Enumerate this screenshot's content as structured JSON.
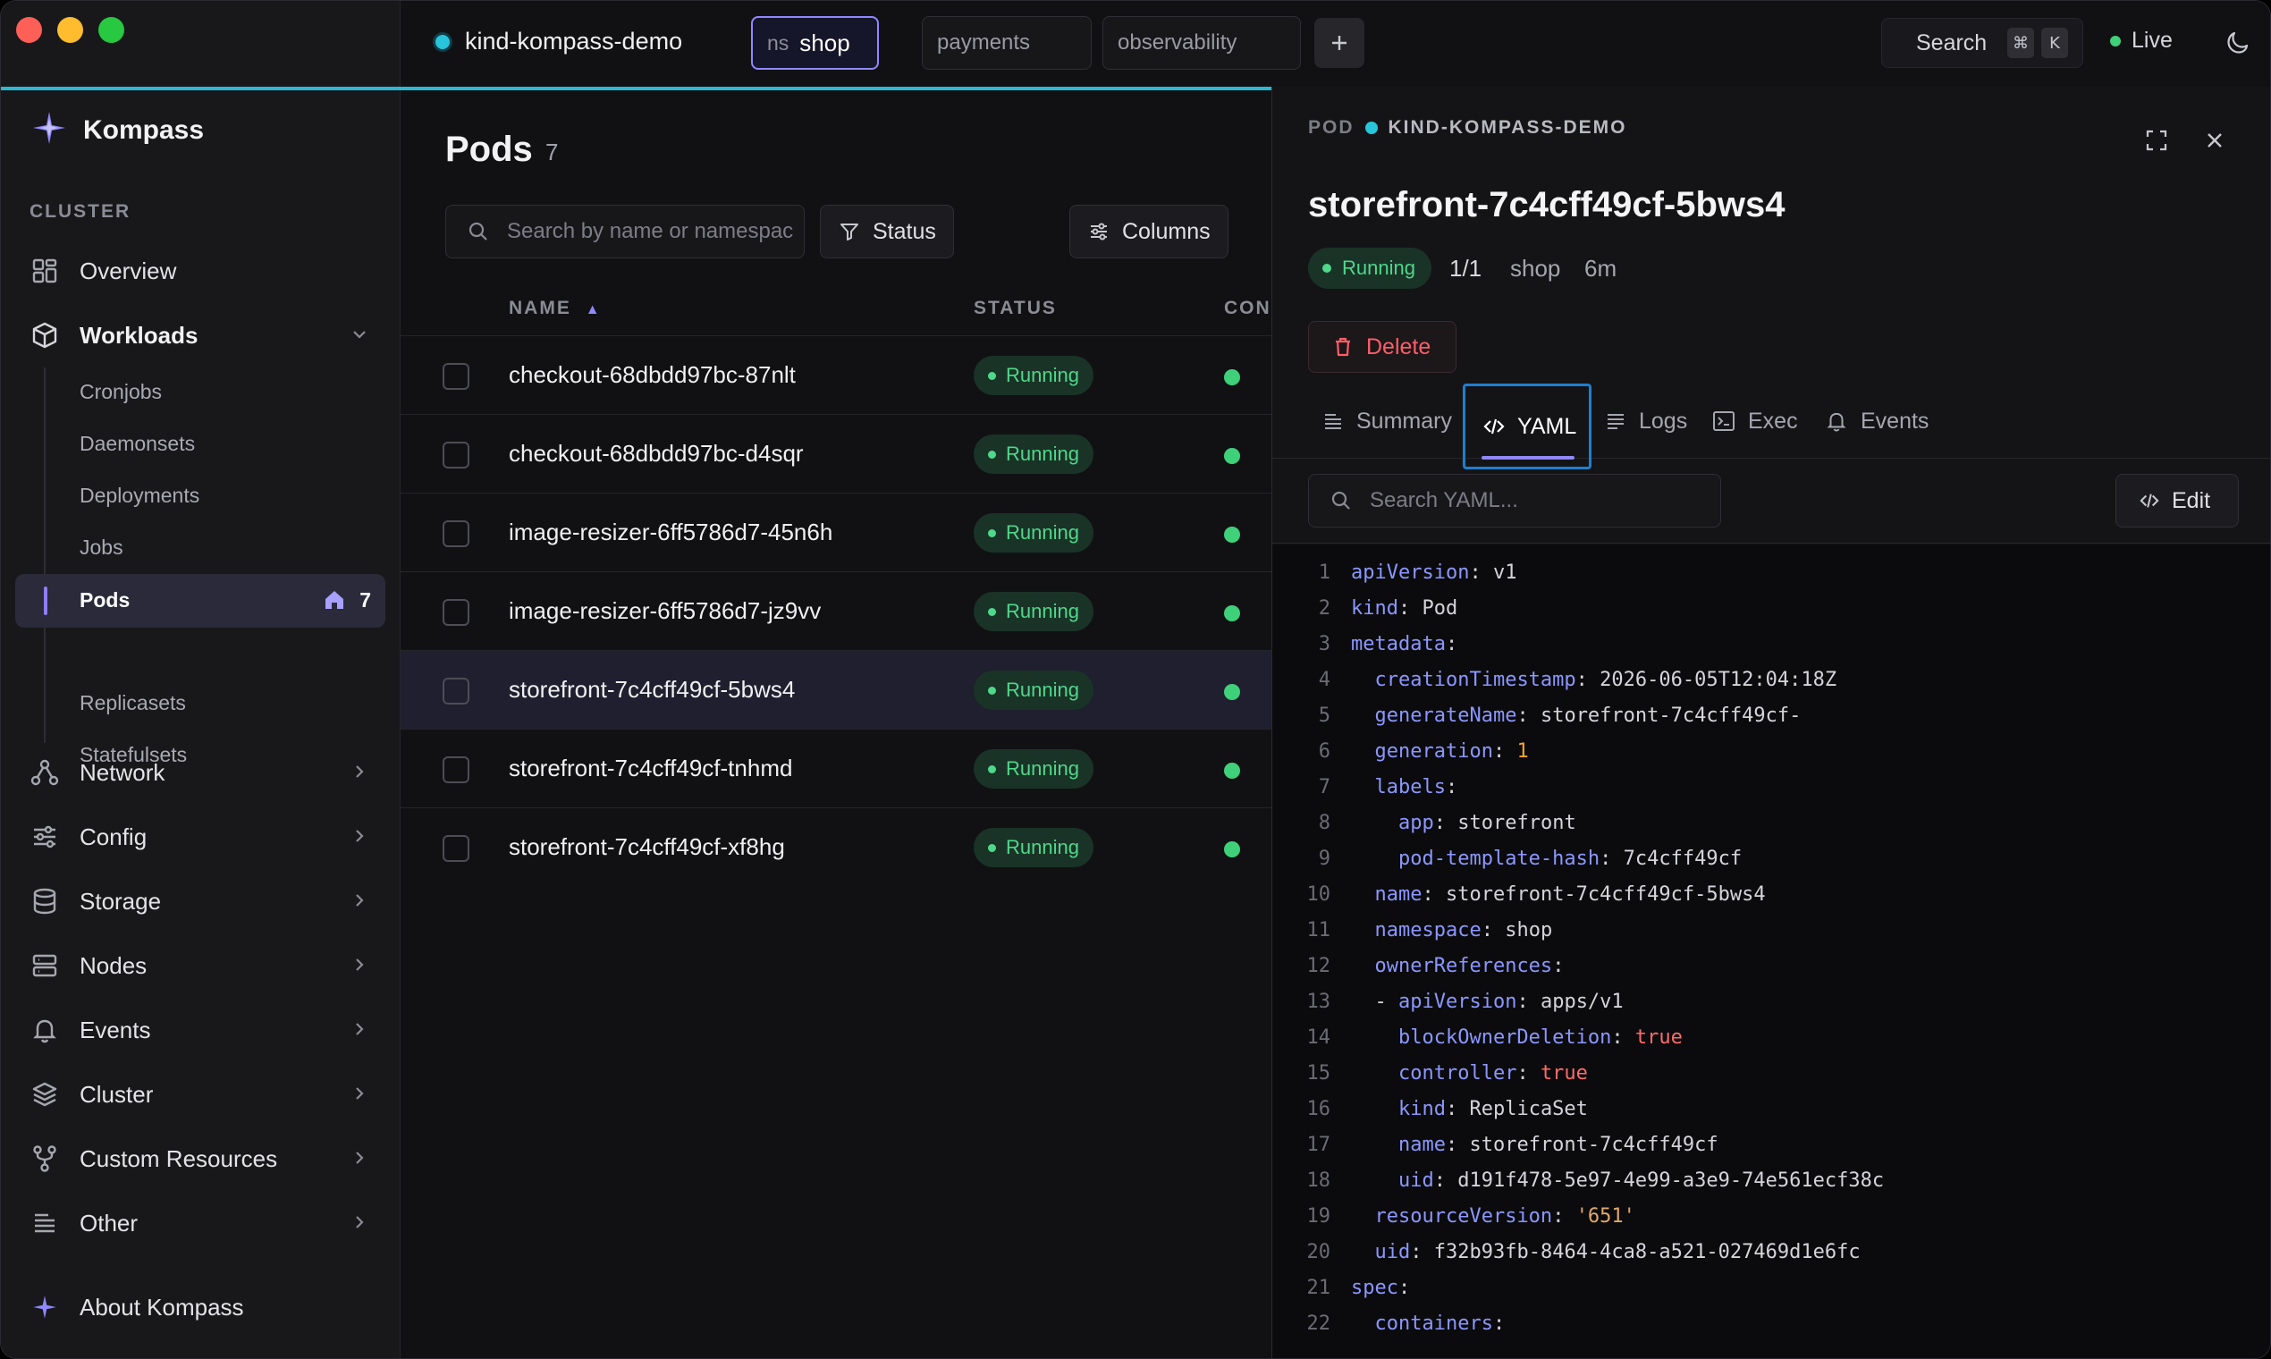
{
  "app": {
    "name": "Kompass",
    "accent": "#8f88ff",
    "context_color": "#27c4dc"
  },
  "topbar": {
    "context": "kind-kompass-demo",
    "ns_prefix": "ns",
    "ns_value": "shop",
    "namespaces": [
      "payments",
      "observability"
    ],
    "search_label": "Search",
    "kbd_cmd": "⌘",
    "kbd_k": "K",
    "live_label": "Live"
  },
  "sidebar": {
    "section": "CLUSTER",
    "items": [
      {
        "label": "Overview",
        "icon": "grid-icon"
      },
      {
        "label": "Workloads",
        "icon": "cube-icon"
      },
      {
        "label": "Network",
        "icon": "network-icon"
      },
      {
        "label": "Config",
        "icon": "sliders-icon"
      },
      {
        "label": "Storage",
        "icon": "database-icon"
      },
      {
        "label": "Nodes",
        "icon": "server-icon"
      },
      {
        "label": "Events",
        "icon": "bell-icon"
      },
      {
        "label": "Cluster",
        "icon": "layers-icon"
      },
      {
        "label": "Custom Resources",
        "icon": "git-fork-icon"
      },
      {
        "label": "Other",
        "icon": "list-icon"
      }
    ],
    "workloads_sub": [
      "Cronjobs",
      "Daemonsets",
      "Deployments",
      "Jobs",
      "Pods",
      "Replicasets",
      "Statefulsets"
    ],
    "active_sub": {
      "label": "Pods",
      "count": "7"
    },
    "about": "About Kompass"
  },
  "list": {
    "title": "Pods",
    "count": "7",
    "search_placeholder": "Search by name or namespace",
    "status_btn": "Status",
    "columns_btn": "Columns",
    "headers": {
      "name": "NAME",
      "sort": "▲",
      "status": "STATUS",
      "containers": "CON"
    },
    "rows": [
      {
        "name": "checkout-68dbdd97bc-87nlt",
        "status": "Running"
      },
      {
        "name": "checkout-68dbdd97bc-d4sqr",
        "status": "Running"
      },
      {
        "name": "image-resizer-6ff5786d7-45n6h",
        "status": "Running"
      },
      {
        "name": "image-resizer-6ff5786d7-jz9vv",
        "status": "Running"
      },
      {
        "name": "storefront-7c4cff49cf-5bws4",
        "status": "Running"
      },
      {
        "name": "storefront-7c4cff49cf-tnhmd",
        "status": "Running"
      },
      {
        "name": "storefront-7c4cff49cf-xf8hg",
        "status": "Running"
      }
    ],
    "selected_index": 4
  },
  "panel": {
    "kind": "POD",
    "cluster": "KIND-KOMPASS-DEMO",
    "title": "storefront-7c4cff49cf-5bws4",
    "status": "Running",
    "ready": "1/1",
    "namespace": "shop",
    "age": "6m",
    "delete_label": "Delete",
    "tabs": [
      "Summary",
      "YAML",
      "Logs",
      "Exec",
      "Events"
    ],
    "active_tab": "YAML",
    "yaml_search_placeholder": "Search YAML...",
    "edit_label": "Edit",
    "yaml_lines": [
      {
        "n": "1",
        "i": 0,
        "k": "apiVersion",
        "v": "v1",
        "t": "s"
      },
      {
        "n": "2",
        "i": 0,
        "k": "kind",
        "v": "Pod",
        "t": "s"
      },
      {
        "n": "3",
        "i": 0,
        "k": "metadata",
        "v": "",
        "t": "s"
      },
      {
        "n": "4",
        "i": 1,
        "k": "creationTimestamp",
        "v": "2026-06-05T12:04:18Z",
        "t": "s"
      },
      {
        "n": "5",
        "i": 1,
        "k": "generateName",
        "v": "storefront-7c4cff49cf-",
        "t": "s"
      },
      {
        "n": "6",
        "i": 1,
        "k": "generation",
        "v": "1",
        "t": "n"
      },
      {
        "n": "7",
        "i": 1,
        "k": "labels",
        "v": "",
        "t": "s"
      },
      {
        "n": "8",
        "i": 2,
        "k": "app",
        "v": "storefront",
        "t": "s"
      },
      {
        "n": "9",
        "i": 2,
        "k": "pod-template-hash",
        "v": "7c4cff49cf",
        "t": "s"
      },
      {
        "n": "10",
        "i": 1,
        "k": "name",
        "v": "storefront-7c4cff49cf-5bws4",
        "t": "s"
      },
      {
        "n": "11",
        "i": 1,
        "k": "namespace",
        "v": "shop",
        "t": "s"
      },
      {
        "n": "12",
        "i": 1,
        "k": "ownerReferences",
        "v": "",
        "t": "s"
      },
      {
        "n": "13",
        "i": 1,
        "dash": true,
        "k": "apiVersion",
        "v": "apps/v1",
        "t": "s"
      },
      {
        "n": "14",
        "i": 2,
        "k": "blockOwnerDeletion",
        "v": "true",
        "t": "b"
      },
      {
        "n": "15",
        "i": 2,
        "k": "controller",
        "v": "true",
        "t": "b"
      },
      {
        "n": "16",
        "i": 2,
        "k": "kind",
        "v": "ReplicaSet",
        "t": "s"
      },
      {
        "n": "17",
        "i": 2,
        "k": "name",
        "v": "storefront-7c4cff49cf",
        "t": "s"
      },
      {
        "n": "18",
        "i": 2,
        "k": "uid",
        "v": "d191f478-5e97-4e99-a3e9-74e561ecf38c",
        "t": "s"
      },
      {
        "n": "19",
        "i": 1,
        "k": "resourceVersion",
        "v": "'651'",
        "t": "q"
      },
      {
        "n": "20",
        "i": 1,
        "k": "uid",
        "v": "f32b93fb-8464-4ca8-a521-027469d1e6fc",
        "t": "s"
      },
      {
        "n": "21",
        "i": 0,
        "k": "spec",
        "v": "",
        "t": "s"
      },
      {
        "n": "22",
        "i": 1,
        "k": "containers",
        "v": "",
        "t": "s"
      }
    ]
  }
}
